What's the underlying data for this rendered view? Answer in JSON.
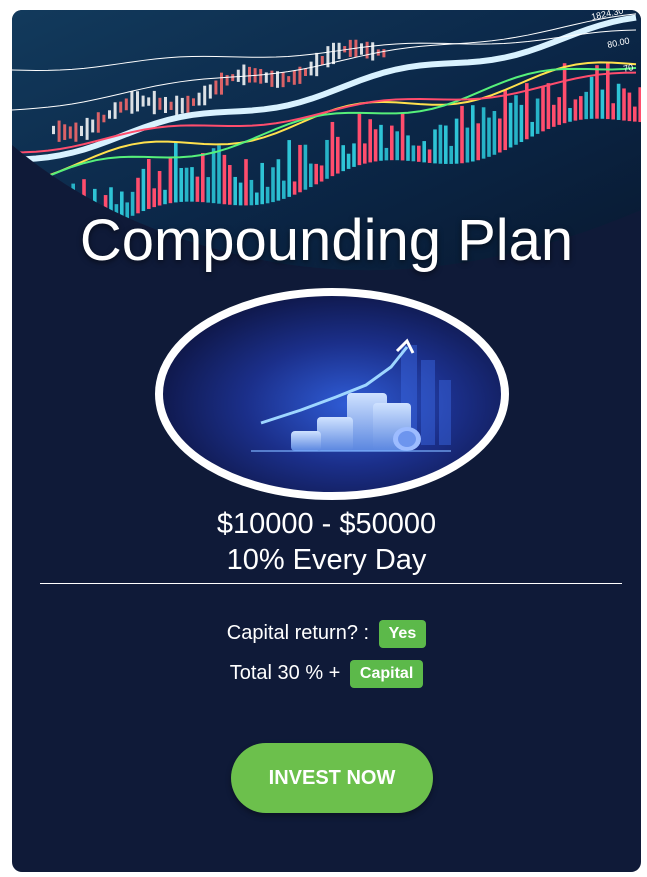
{
  "plan": {
    "title": "Compounding Plan",
    "range": "$10000 - $50000",
    "rate": "10% Every Day",
    "capital_return_label": "Capital return? :",
    "capital_return_value": "Yes",
    "total_label": "Total 30 % +",
    "total_badge": "Capital",
    "cta_label": "INVEST NOW"
  },
  "hero": {
    "tick_labels": [
      "1824.30",
      "80.00",
      "70"
    ]
  },
  "colors": {
    "card_background": "#0f1a38",
    "accent_green": "#6cc04c",
    "badge_green": "#5cb94a",
    "text": "#ffffff"
  }
}
